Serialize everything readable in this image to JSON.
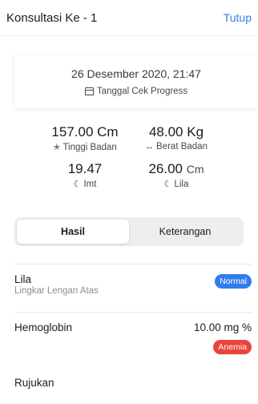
{
  "header": {
    "title": "Konsultasi Ke - 1",
    "close_label": "Tutup"
  },
  "date_card": {
    "datetime": "26 Desember 2020, 21:47",
    "subtitle": "Tanggal Cek Progress",
    "icon": "calendar-icon"
  },
  "stats": [
    {
      "value": "157.00 Cm",
      "unit": "",
      "label": "Tinggi Badan",
      "icon": "person-icon"
    },
    {
      "value": "48.00 Kg",
      "unit": "",
      "label": "Berat Badan",
      "icon": "arrows-horizontal-icon"
    },
    {
      "value": "19.47",
      "unit": "",
      "label": "Imt",
      "icon": "moon-icon"
    },
    {
      "value": "26.00",
      "unit": "Cm",
      "label": "Lila",
      "icon": "moon-icon"
    }
  ],
  "tabs": [
    {
      "label": "Hasil",
      "active": true
    },
    {
      "label": "Keterangan",
      "active": false
    }
  ],
  "results": {
    "lila": {
      "title": "Lila",
      "subtitle": "Lingkar Lengan Atas",
      "badge": "Normal",
      "badge_color": "#2f7ded"
    },
    "hemoglobin": {
      "title": "Hemoglobin",
      "value": "10.00 mg %",
      "badge": "Anemia",
      "badge_color": "#e9443b"
    },
    "rujukan": {
      "title": "Rujukan"
    }
  },
  "colors": {
    "accent": "#2f80ed"
  }
}
